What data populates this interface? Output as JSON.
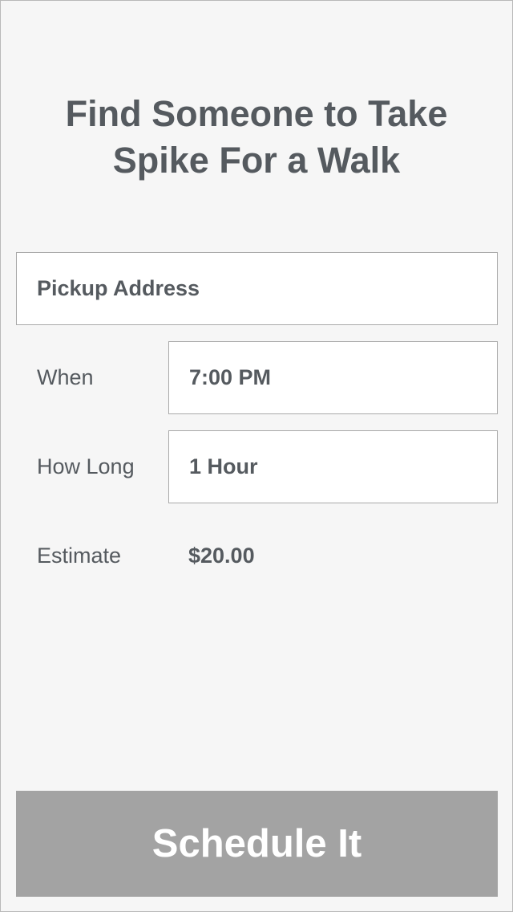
{
  "header": {
    "title_line1": "Find Someone to Take",
    "title_line2": "Spike For a Walk"
  },
  "form": {
    "pickup_address": "Pickup Address",
    "when_label": "When",
    "when_value": "7:00 PM",
    "how_long_label": "How Long",
    "how_long_value": "1 Hour",
    "estimate_label": "Estimate",
    "estimate_value": "$20.00"
  },
  "actions": {
    "schedule_label": "Schedule It"
  },
  "colors": {
    "background": "#f6f6f6",
    "text": "#555a5f",
    "field_background": "#ffffff",
    "field_border": "#a9a9a9",
    "button_background": "#a3a3a3",
    "button_text": "#ffffff"
  }
}
